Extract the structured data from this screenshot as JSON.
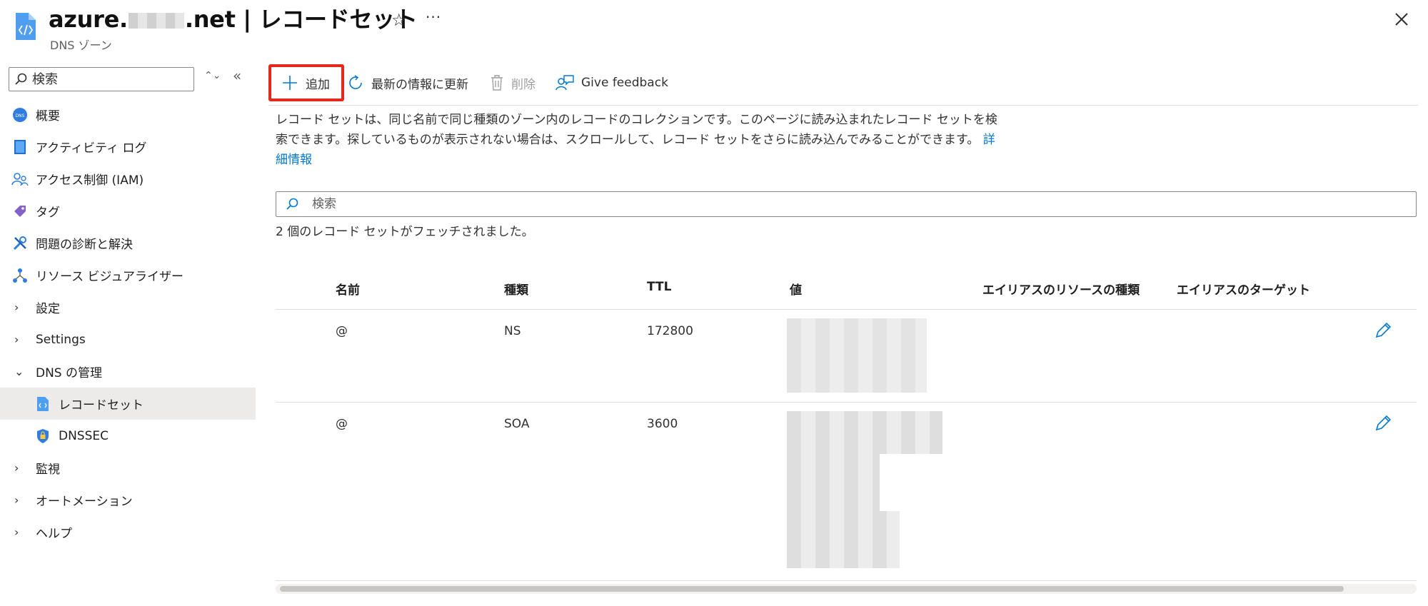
{
  "header": {
    "title_prefix": "azure.",
    "title_suffix": ".net | レコードセット",
    "subtitle": "DNS ゾーン",
    "star": "☆",
    "more": "···"
  },
  "sidebar": {
    "search_placeholder": "検索",
    "updown": "⌃⌄",
    "collapse": "«",
    "items": [
      {
        "label": "概要",
        "icon": "dns-icon"
      },
      {
        "label": "アクティビティ ログ",
        "icon": "activity-log-icon"
      },
      {
        "label": "アクセス制御 (IAM)",
        "icon": "people-icon"
      },
      {
        "label": "タグ",
        "icon": "tag-icon"
      },
      {
        "label": "問題の診断と解決",
        "icon": "wrench-icon"
      },
      {
        "label": "リソース ビジュアライザー",
        "icon": "hierarchy-icon"
      },
      {
        "label": "設定",
        "expander": "›"
      },
      {
        "label": "Settings",
        "expander": "›"
      },
      {
        "label": "DNS の管理",
        "expander": "⌄"
      },
      {
        "label": "レコードセット",
        "icon": "recordset-icon"
      },
      {
        "label": "DNSSEC",
        "icon": "shield-icon"
      },
      {
        "label": "監視",
        "expander": "›"
      },
      {
        "label": "オートメーション",
        "expander": "›"
      },
      {
        "label": "ヘルプ",
        "expander": "›"
      }
    ]
  },
  "toolbar": {
    "add": "追加",
    "refresh": "最新の情報に更新",
    "delete": "削除",
    "feedback": "Give feedback"
  },
  "description": {
    "text": "レコード セットは、同じ名前で同じ種類のゾーン内のレコードのコレクションです。このページに読み込まれたレコード セットを検索できます。探しているものが表示されない場合は、スクロールして、レコード セットをさらに読み込んでみることができます。",
    "link": "詳細情報"
  },
  "filter": {
    "placeholder": "検索"
  },
  "fetched": "2 個のレコード セットがフェッチされました。",
  "table": {
    "columns": [
      "名前",
      "種類",
      "TTL",
      "値",
      "エイリアスのリソースの種類",
      "エイリアスのターゲット"
    ],
    "rows": [
      {
        "name": "@",
        "type": "NS",
        "ttl": "172800"
      },
      {
        "name": "@",
        "type": "SOA",
        "ttl": "3600"
      }
    ]
  },
  "colors": {
    "accent": "#0078d4",
    "highlight": "#e5281c"
  }
}
